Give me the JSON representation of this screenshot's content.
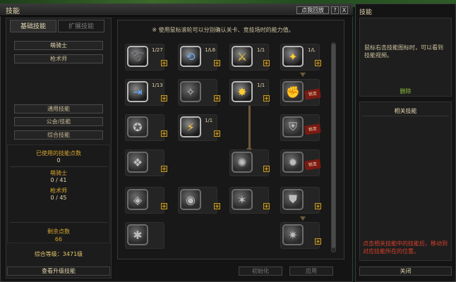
{
  "window": {
    "title": "技能",
    "preview_button": "点我回放",
    "help_button": "?",
    "close_button": "X"
  },
  "tabs": [
    {
      "label": "基础技能"
    },
    {
      "label": "扩展技能"
    }
  ],
  "left": {
    "class_name": "萌骑士",
    "class_sub": "枪术师",
    "buttons": [
      "通用技能",
      "公会/技能",
      "综合技能"
    ]
  },
  "stats": {
    "used_label": "已使用的技能点数",
    "used_value": "0",
    "class1_label": "萌骑士",
    "class1_value": "0 / 41",
    "class2_label": "枪术师",
    "class2_value": "0 / 45",
    "remain_label": "剩余点数",
    "remain_value": "66",
    "total": "综合等级：3471级"
  },
  "bottom_left_button": "查看升级技能",
  "center": {
    "notice": "※ 使用鼠标滚轮可以分别确认关卡、竞技场时的能力值。",
    "skills": [
      {
        "level": "1/27",
        "icon": "blade-icon"
      },
      {
        "level": "1/L6",
        "icon": "whirl-icon"
      },
      {
        "level": "1/1",
        "icon": "slash-icon"
      },
      {
        "level": "1/L",
        "icon": "strike-icon"
      },
      {
        "level": "1/13",
        "icon": "thrust-icon"
      },
      {
        "level": "1/1",
        "icon": "burst-icon"
      },
      {
        "level": "1/1",
        "icon": "dash-icon"
      }
    ],
    "lock_label": "锁定",
    "buttons": {
      "reset": "初始化",
      "apply": "应用"
    }
  },
  "right": {
    "title": "技能",
    "hint": "鼠标右击技能图标时，可以看到技能视频。",
    "delete": "删除",
    "related_title": "相关技能",
    "note": "点击相关技能中的技能后，移动到对应技能所在的位置。",
    "close_button": "关闭"
  }
}
